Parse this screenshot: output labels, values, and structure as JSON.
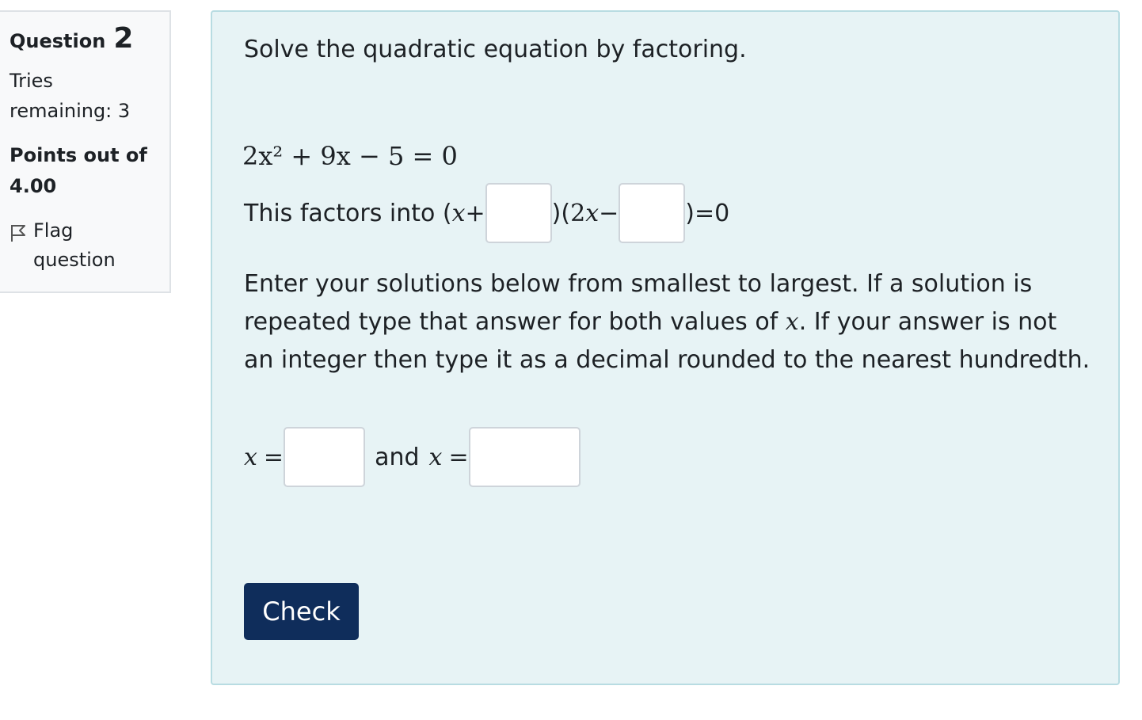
{
  "info": {
    "question_label": "Question",
    "question_number": "2",
    "tries_label": "Tries remaining: 3",
    "points_label": "Points out of 4.00",
    "flag_label": "Flag question",
    "flag_icon": "flag-outline-icon"
  },
  "question": {
    "prompt": "Solve the quadratic equation by factoring.",
    "equation": "2x² + 9x − 5 = 0",
    "factors_prefix": "This factors into (",
    "factor1_var": "x",
    "factor1_op": "+",
    "factor_middle": ")(",
    "factor2_coef": "2",
    "factor2_var": "x",
    "factor2_op": "−",
    "factors_suffix": ")=0",
    "factor1_value": "",
    "factor2_value": "",
    "instructions_part1": "Enter your solutions below from smallest to largest. If a solution is repeated type that answer for both values of ",
    "instructions_var": "x",
    "instructions_part2": ". If your answer is not an integer then type it as a decimal rounded to the nearest hundredth.",
    "solution1_var": "x",
    "solution1_eq": "=",
    "solution_joiner": "and",
    "solution2_var": "x",
    "solution2_eq": "=",
    "solution1_value": "",
    "solution2_value": ""
  },
  "check_label": "Check",
  "colors": {
    "panel_bg": "#e7f3f5",
    "panel_border": "#b8dce2",
    "check_button": "#0f2d5b"
  }
}
